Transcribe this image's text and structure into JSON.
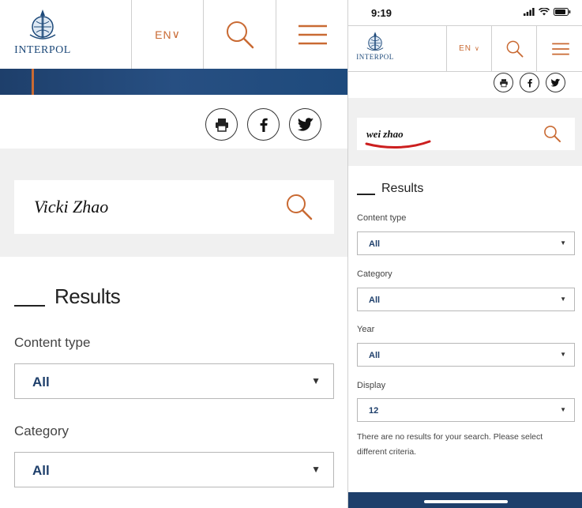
{
  "left": {
    "logo_text": "INTERPOL",
    "language": "EN",
    "search": {
      "value": "Vicki Zhao"
    },
    "results_heading": "Results",
    "filters": [
      {
        "label": "Content type",
        "value": "All"
      },
      {
        "label": "Category",
        "value": "All"
      }
    ]
  },
  "right": {
    "time": "9:19",
    "logo_text": "INTERPOL",
    "language": "EN",
    "search": {
      "value": "wei zhao"
    },
    "results_heading": "Results",
    "filters": [
      {
        "label": "Content type",
        "value": "All"
      },
      {
        "label": "Category",
        "value": "All"
      },
      {
        "label": "Year",
        "value": "All"
      },
      {
        "label": "Display",
        "value": "12"
      }
    ],
    "no_results_message": "There are no results for your search. Please select different criteria."
  },
  "colors": {
    "accent_orange": "#c96a33",
    "navy": "#1e3f6b",
    "annotation_red": "#cc1f1f"
  },
  "icons": [
    "interpol-logo-icon",
    "search-icon",
    "menu-icon",
    "print-icon",
    "facebook-icon",
    "twitter-icon",
    "chevron-down-icon",
    "signal-icon",
    "wifi-icon",
    "battery-icon"
  ]
}
